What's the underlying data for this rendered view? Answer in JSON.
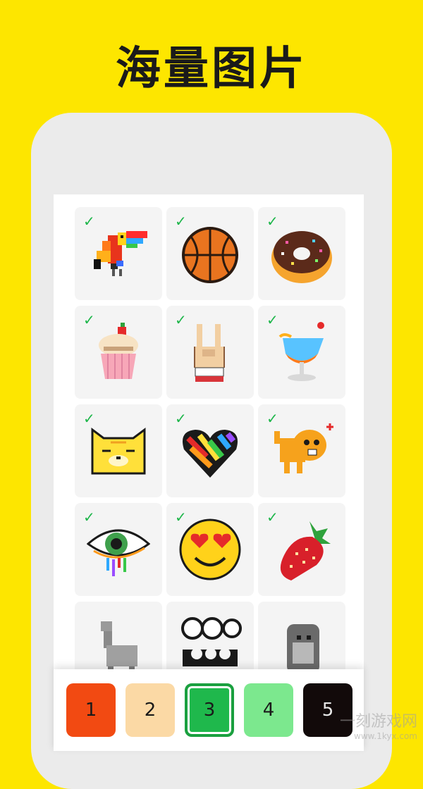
{
  "headline": "海量图片",
  "grid": {
    "items": [
      {
        "name": "toucan",
        "completed": true
      },
      {
        "name": "basketball",
        "completed": true
      },
      {
        "name": "donut",
        "completed": true
      },
      {
        "name": "cupcake",
        "completed": true
      },
      {
        "name": "rock-hand",
        "completed": true
      },
      {
        "name": "cocktail",
        "completed": true
      },
      {
        "name": "cat-face",
        "completed": true
      },
      {
        "name": "rainbow-heart",
        "completed": true
      },
      {
        "name": "angry-cat",
        "completed": true
      },
      {
        "name": "rainbow-eye",
        "completed": true
      },
      {
        "name": "heart-eyes-emoji",
        "completed": true
      },
      {
        "name": "strawberry",
        "completed": true
      },
      {
        "name": "llama",
        "completed": false
      },
      {
        "name": "panda-sushi",
        "completed": false
      },
      {
        "name": "gorilla",
        "completed": false
      }
    ],
    "check_symbol": "✓"
  },
  "palette": {
    "selected": "3",
    "colors": [
      {
        "number": "1",
        "color": "#f24a12"
      },
      {
        "number": "2",
        "color": "#fbd9a5"
      },
      {
        "number": "3",
        "color": "#1fb84c"
      },
      {
        "number": "4",
        "color": "#7ce88e"
      },
      {
        "number": "5",
        "color": "#120a0a"
      }
    ]
  },
  "watermark": {
    "text": "一刻游戏网",
    "url": "www.1kyx.com"
  }
}
